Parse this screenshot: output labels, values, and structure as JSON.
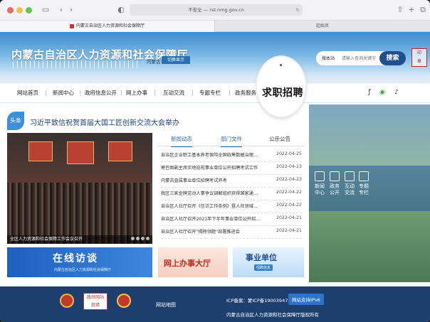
{
  "browser": {
    "address": "不安全 — rst.nmg.gov.cn",
    "tabs": [
      "内蒙古自治区人力资源和社会保障厅",
      "起始页"
    ]
  },
  "header": {
    "site_title": "内蒙古自治区人力资源和社会保障厅",
    "region_label": "内蒙古",
    "region_button": "切换显示",
    "search_select": "搜本站",
    "search_placeholder": "请输入查询关键字",
    "search_button": "搜索"
  },
  "nav": {
    "items": [
      "网站首页",
      "新闻中心",
      "政府信息公开",
      "网上办事",
      "互动交流",
      "专题专栏",
      "政务服务"
    ],
    "magnified": "求职招聘"
  },
  "headline": {
    "badge": "头条",
    "text": "习近平致信祝贺首届大国工匠创新交流大会举办"
  },
  "photo": {
    "caption": "全区人力资源和社会保障工作会议召开"
  },
  "news": {
    "tabs": [
      "新闻动态",
      "部门文件",
      "公示公告"
    ],
    "rows": [
      {
        "title": "自治区企业职工基本养老保险全国统筹数据治理工...",
        "date": "2022-04-25"
      },
      {
        "title": "寄巴图副主席实地巡视事业单位公开招聘考试工作",
        "date": "2022-04-23"
      },
      {
        "title": "内蒙古直属事业单位招聘考试开考",
        "date": "2022-04-23"
      },
      {
        "title": "我区三家金牌劳动人事争议调解组织获得国家通报表扬",
        "date": "2022-04-22"
      },
      {
        "title": "自治区人社厅召开《信访工作条例》暨人社领域信访...",
        "date": "2022-04-22"
      },
      {
        "title": "自治区人社厅召开2021年下半年事业单位公开招聘分...",
        "date": "2022-04-21"
      },
      {
        "title": "自治区人社厅召开\"揭榜领题\"部署推进会",
        "date": "2022-04-21"
      }
    ]
  },
  "banners": {
    "b1_title": "在线访谈",
    "b1_sub": "内蒙古自治区人力资源和社会保障厅",
    "b2_title": "网上办事大厅",
    "b3_title": "事业单位",
    "b3_sub": "招聘信息"
  },
  "services": [
    {
      "label": "新闻\n中心"
    },
    {
      "label": "政务\n公开"
    },
    {
      "label": "互动\n交流"
    },
    {
      "label": "专题\n专栏"
    }
  ],
  "footer": {
    "gov_box": "政府网站\n找错",
    "site_map": "网站地图",
    "icp": "ICP备案：蒙ICP备19003947号",
    "ipv6": "网站支持IPv6",
    "org": "内蒙古自治区人力资源和社会保障厅版权所有"
  },
  "colors": {
    "brand_blue": "#1d3f6d",
    "accent_blue": "#2a6db5",
    "nav_text": "#222222"
  }
}
